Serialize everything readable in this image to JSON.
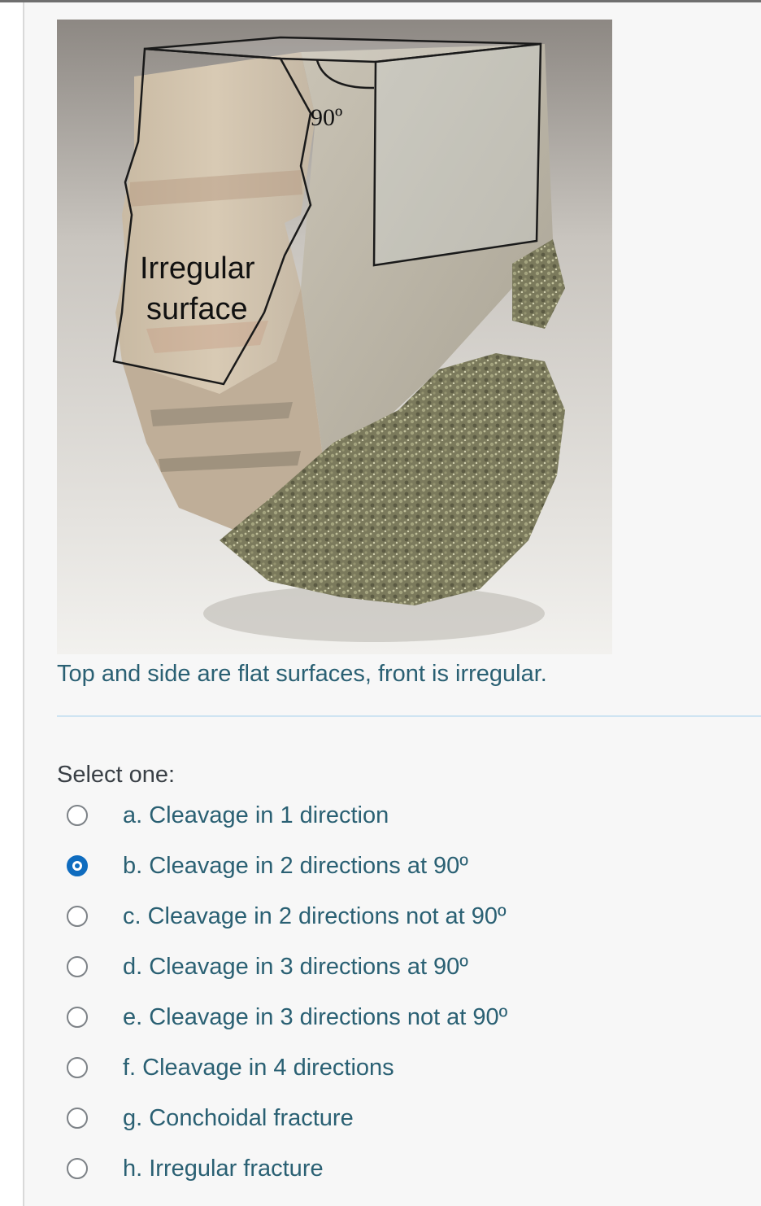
{
  "figure": {
    "annotation_angle": "90º",
    "annotation_surface_line1": "Irregular",
    "annotation_surface_line2": "surface"
  },
  "caption": "Top and side are flat surfaces, front is irregular.",
  "question": {
    "prompt": "Select one:",
    "selected_index": 1,
    "options": [
      {
        "label": "a. Cleavage in 1 direction",
        "checked": false
      },
      {
        "label": "b. Cleavage in 2 directions at 90º",
        "checked": true
      },
      {
        "label": "c. Cleavage in 2 directions not at 90º",
        "checked": false
      },
      {
        "label": "d. Cleavage in 3 directions at 90º",
        "checked": false
      },
      {
        "label": "e. Cleavage in 3 directions not at 90º",
        "checked": false
      },
      {
        "label": "f. Cleavage in 4 directions",
        "checked": false
      },
      {
        "label": "g. Conchoidal fracture",
        "checked": false
      },
      {
        "label": "h. Irregular fracture",
        "checked": false
      }
    ]
  },
  "colors": {
    "text": "#2a6073",
    "prompt_text": "#3a4046",
    "radio_checked": "#0f6cbf",
    "divider": "#cfe4f2"
  }
}
